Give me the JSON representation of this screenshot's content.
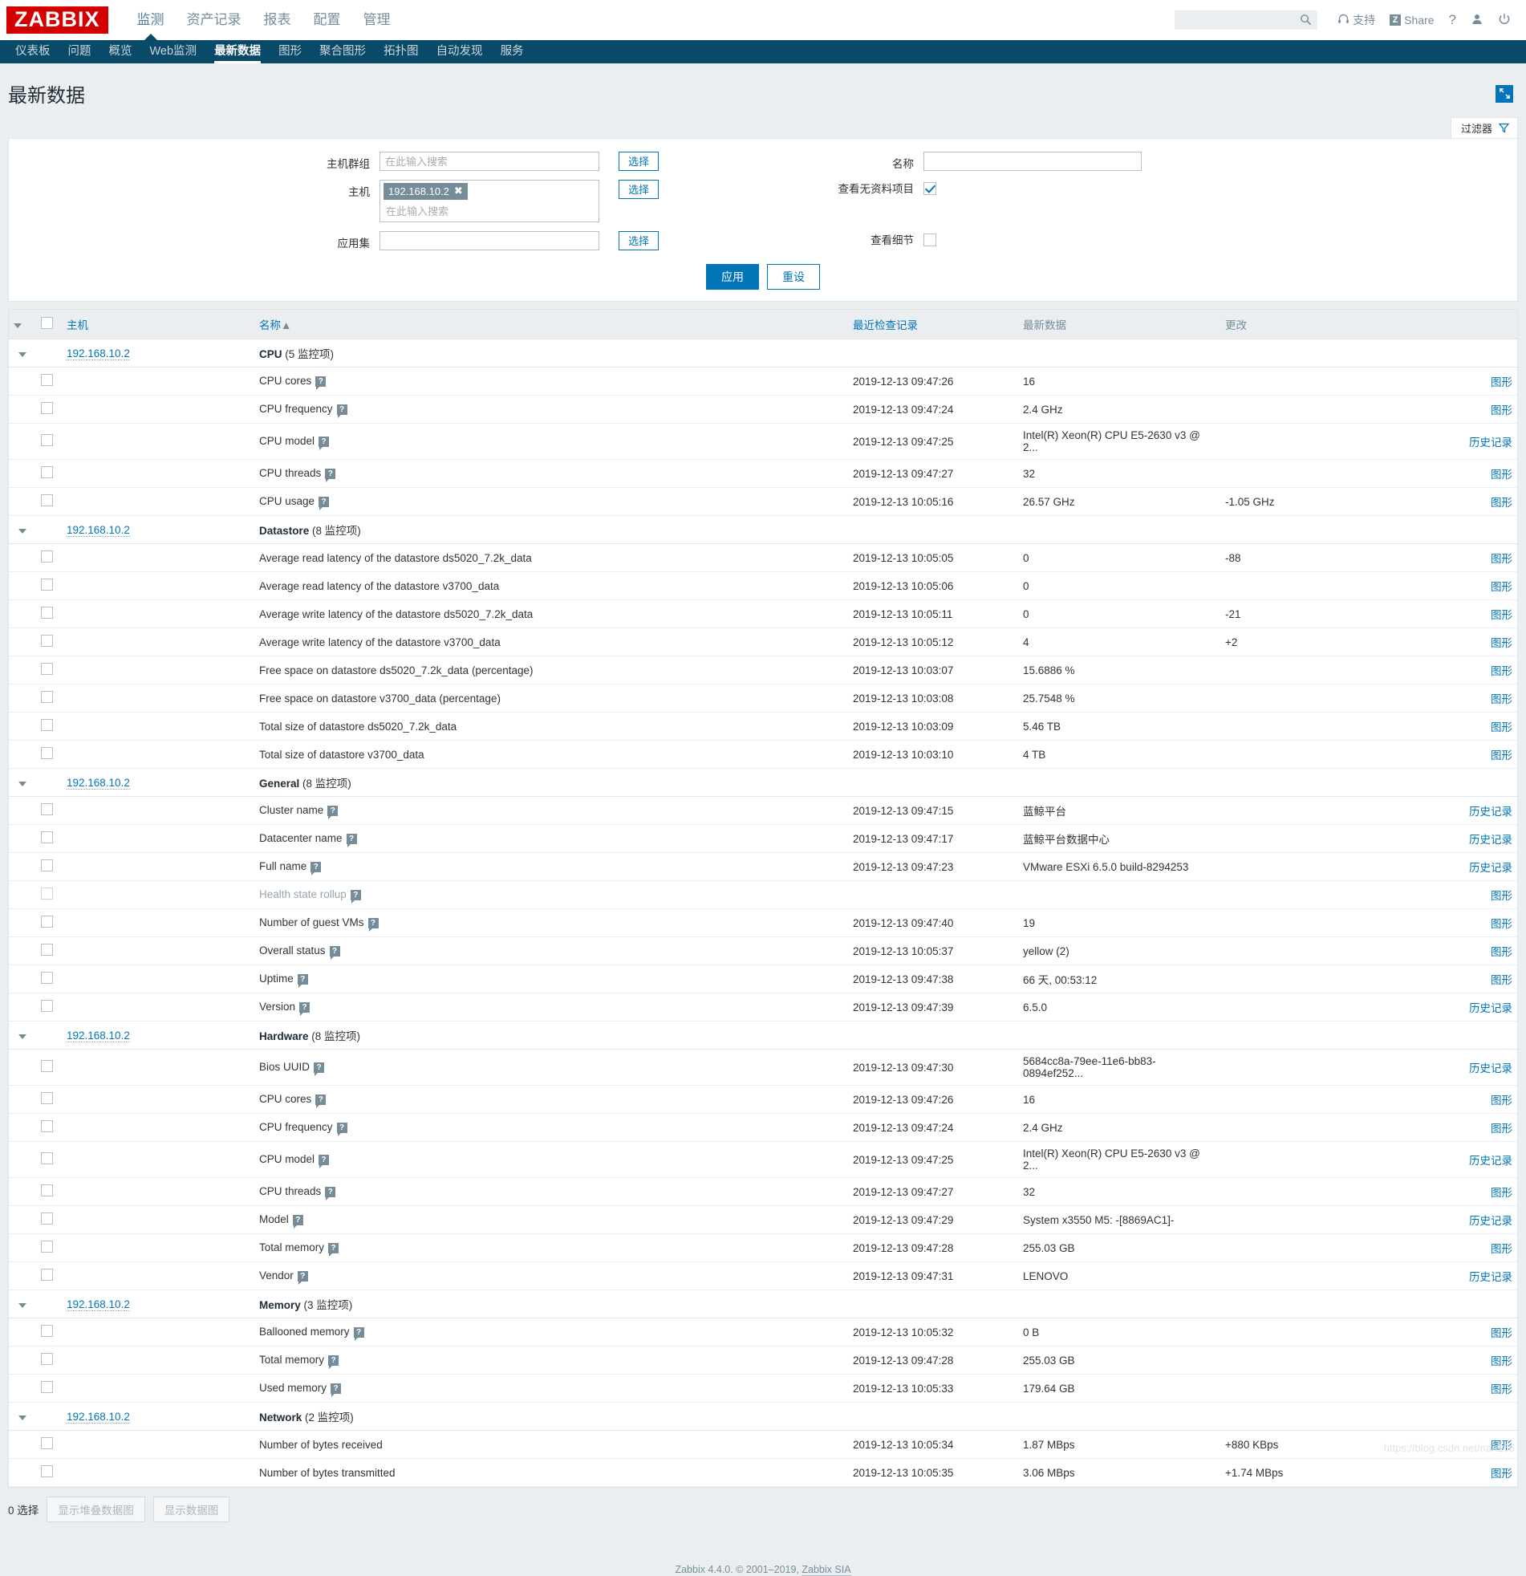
{
  "brand": {
    "logo": "ZABBIX"
  },
  "main_menu": [
    {
      "label": "监测",
      "selected": true
    },
    {
      "label": "资产记录",
      "selected": false
    },
    {
      "label": "报表",
      "selected": false
    },
    {
      "label": "配置",
      "selected": false
    },
    {
      "label": "管理",
      "selected": false
    }
  ],
  "header_right": {
    "search_placeholder": "",
    "search_value": "",
    "search_icon": "search-icon",
    "support_label": "支持",
    "support_icon": "headset-icon",
    "share_label": "Share",
    "share_badge": "Z",
    "help_label": "?",
    "user_icon": "user-icon",
    "signout_icon": "power-icon"
  },
  "sub_menu": [
    {
      "label": "仪表板",
      "selected": false
    },
    {
      "label": "问题",
      "selected": false
    },
    {
      "label": "概览",
      "selected": false
    },
    {
      "label": "Web监测",
      "selected": false
    },
    {
      "label": "最新数据",
      "selected": true
    },
    {
      "label": "图形",
      "selected": false
    },
    {
      "label": "聚合图形",
      "selected": false
    },
    {
      "label": "拓扑图",
      "selected": false
    },
    {
      "label": "自动发现",
      "selected": false
    },
    {
      "label": "服务",
      "selected": false
    }
  ],
  "page": {
    "title": "最新数据",
    "kiosk_icon": "expand-icon"
  },
  "filter": {
    "tab_label": "过滤器",
    "funnel_icon": "filter-funnel-icon",
    "hostgroup_label": "主机群组",
    "hostgroup_placeholder": "在此输入搜索",
    "hostgroup_value": "",
    "host_label": "主机",
    "host_chip": "192.168.10.2",
    "host_chip_remove": "✖",
    "host_placeholder": "在此输入搜索",
    "application_label": "应用集",
    "application_value": "",
    "select_button": "选择",
    "name_label": "名称",
    "name_value": "",
    "show_items_without_data_label": "查看无资料项目",
    "show_items_without_data_checked": true,
    "show_details_label": "查看细节",
    "show_details_checked": false,
    "apply_button": "应用",
    "reset_button": "重设"
  },
  "table": {
    "columns": {
      "host": "主机",
      "name": "名称",
      "name_sort_arrow": "▲",
      "last_check": "最近检查记录",
      "last_value": "最新数据",
      "change": "更改"
    },
    "host_ip": "192.168.10.2",
    "count_suffix": "监控项",
    "action_graph": "图形",
    "action_history": "历史记录",
    "groups": [
      {
        "name": "CPU",
        "count": "5",
        "rows": [
          {
            "name": "CPU cores",
            "info": true,
            "last_check": "2019-12-13 09:47:26",
            "last_value": "16",
            "change": "",
            "action": "图形"
          },
          {
            "name": "CPU frequency",
            "info": true,
            "last_check": "2019-12-13 09:47:24",
            "last_value": "2.4 GHz",
            "change": "",
            "action": "图形"
          },
          {
            "name": "CPU model",
            "info": true,
            "last_check": "2019-12-13 09:47:25",
            "last_value": "Intel(R) Xeon(R) CPU E5-2630 v3 @ 2...",
            "change": "",
            "action": "历史记录"
          },
          {
            "name": "CPU threads",
            "info": true,
            "last_check": "2019-12-13 09:47:27",
            "last_value": "32",
            "change": "",
            "action": "图形"
          },
          {
            "name": "CPU usage",
            "info": true,
            "last_check": "2019-12-13 10:05:16",
            "last_value": "26.57 GHz",
            "change": "-1.05 GHz",
            "action": "图形"
          }
        ]
      },
      {
        "name": "Datastore",
        "count": "8",
        "rows": [
          {
            "name": "Average read latency of the datastore ds5020_7.2k_data",
            "info": false,
            "last_check": "2019-12-13 10:05:05",
            "last_value": "0",
            "change": "-88",
            "action": "图形"
          },
          {
            "name": "Average read latency of the datastore v3700_data",
            "info": false,
            "last_check": "2019-12-13 10:05:06",
            "last_value": "0",
            "change": "",
            "action": "图形"
          },
          {
            "name": "Average write latency of the datastore ds5020_7.2k_data",
            "info": false,
            "last_check": "2019-12-13 10:05:11",
            "last_value": "0",
            "change": "-21",
            "action": "图形"
          },
          {
            "name": "Average write latency of the datastore v3700_data",
            "info": false,
            "last_check": "2019-12-13 10:05:12",
            "last_value": "4",
            "change": "+2",
            "action": "图形"
          },
          {
            "name": "Free space on datastore ds5020_7.2k_data (percentage)",
            "info": false,
            "last_check": "2019-12-13 10:03:07",
            "last_value": "15.6886 %",
            "change": "",
            "action": "图形"
          },
          {
            "name": "Free space on datastore v3700_data (percentage)",
            "info": false,
            "last_check": "2019-12-13 10:03:08",
            "last_value": "25.7548 %",
            "change": "",
            "action": "图形"
          },
          {
            "name": "Total size of datastore ds5020_7.2k_data",
            "info": false,
            "last_check": "2019-12-13 10:03:09",
            "last_value": "5.46 TB",
            "change": "",
            "action": "图形"
          },
          {
            "name": "Total size of datastore v3700_data",
            "info": false,
            "last_check": "2019-12-13 10:03:10",
            "last_value": "4 TB",
            "change": "",
            "action": "图形"
          }
        ]
      },
      {
        "name": "General",
        "count": "8",
        "rows": [
          {
            "name": "Cluster name",
            "info": true,
            "last_check": "2019-12-13 09:47:15",
            "last_value": "蓝鲸平台",
            "change": "",
            "action": "历史记录"
          },
          {
            "name": "Datacenter name",
            "info": true,
            "last_check": "2019-12-13 09:47:17",
            "last_value": "蓝鲸平台数据中心",
            "change": "",
            "action": "历史记录"
          },
          {
            "name": "Full name",
            "info": true,
            "last_check": "2019-12-13 09:47:23",
            "last_value": "VMware ESXi 6.5.0 build-8294253",
            "change": "",
            "action": "历史记录"
          },
          {
            "name": "Health state rollup",
            "info": true,
            "disabled": true,
            "last_check": "",
            "last_value": "",
            "change": "",
            "action": "图形"
          },
          {
            "name": "Number of guest VMs",
            "info": true,
            "last_check": "2019-12-13 09:47:40",
            "last_value": "19",
            "change": "",
            "action": "图形"
          },
          {
            "name": "Overall status",
            "info": true,
            "last_check": "2019-12-13 10:05:37",
            "last_value": "yellow (2)",
            "change": "",
            "action": "图形"
          },
          {
            "name": "Uptime",
            "info": true,
            "last_check": "2019-12-13 09:47:38",
            "last_value": "66 天, 00:53:12",
            "change": "",
            "action": "图形"
          },
          {
            "name": "Version",
            "info": true,
            "last_check": "2019-12-13 09:47:39",
            "last_value": "6.5.0",
            "change": "",
            "action": "历史记录"
          }
        ]
      },
      {
        "name": "Hardware",
        "count": "8",
        "rows": [
          {
            "name": "Bios UUID",
            "info": true,
            "last_check": "2019-12-13 09:47:30",
            "last_value": "5684cc8a-79ee-11e6-bb83-0894ef252...",
            "change": "",
            "action": "历史记录"
          },
          {
            "name": "CPU cores",
            "info": true,
            "last_check": "2019-12-13 09:47:26",
            "last_value": "16",
            "change": "",
            "action": "图形"
          },
          {
            "name": "CPU frequency",
            "info": true,
            "last_check": "2019-12-13 09:47:24",
            "last_value": "2.4 GHz",
            "change": "",
            "action": "图形"
          },
          {
            "name": "CPU model",
            "info": true,
            "last_check": "2019-12-13 09:47:25",
            "last_value": "Intel(R) Xeon(R) CPU E5-2630 v3 @ 2...",
            "change": "",
            "action": "历史记录"
          },
          {
            "name": "CPU threads",
            "info": true,
            "last_check": "2019-12-13 09:47:27",
            "last_value": "32",
            "change": "",
            "action": "图形"
          },
          {
            "name": "Model",
            "info": true,
            "last_check": "2019-12-13 09:47:29",
            "last_value": "System x3550 M5: -[8869AC1]-",
            "change": "",
            "action": "历史记录"
          },
          {
            "name": "Total memory",
            "info": true,
            "last_check": "2019-12-13 09:47:28",
            "last_value": "255.03 GB",
            "change": "",
            "action": "图形"
          },
          {
            "name": "Vendor",
            "info": true,
            "last_check": "2019-12-13 09:47:31",
            "last_value": "LENOVO",
            "change": "",
            "action": "历史记录"
          }
        ]
      },
      {
        "name": "Memory",
        "count": "3",
        "rows": [
          {
            "name": "Ballooned memory",
            "info": true,
            "last_check": "2019-12-13 10:05:32",
            "last_value": "0 B",
            "change": "",
            "action": "图形"
          },
          {
            "name": "Total memory",
            "info": true,
            "last_check": "2019-12-13 09:47:28",
            "last_value": "255.03 GB",
            "change": "",
            "action": "图形"
          },
          {
            "name": "Used memory",
            "info": true,
            "last_check": "2019-12-13 10:05:33",
            "last_value": "179.64 GB",
            "change": "",
            "action": "图形"
          }
        ]
      },
      {
        "name": "Network",
        "count": "2",
        "rows": [
          {
            "name": "Number of bytes received",
            "info": false,
            "last_check": "2019-12-13 10:05:34",
            "last_value": "1.87 MBps",
            "change": "+880 KBps",
            "action": "图形"
          },
          {
            "name": "Number of bytes transmitted",
            "info": false,
            "last_check": "2019-12-13 10:05:35",
            "last_value": "3.06 MBps",
            "change": "+1.74 MBps",
            "action": "图形"
          }
        ]
      }
    ]
  },
  "footer": {
    "selected_count": "0 选择",
    "stacked_graph_button": "显示堆叠数据图",
    "graph_button": "显示数据图",
    "copyright": "Zabbix 4.4.0. © 2001–2019, ",
    "copyright_link": "Zabbix SIA",
    "watermark": "https://blog.csdn.net/nan156"
  }
}
